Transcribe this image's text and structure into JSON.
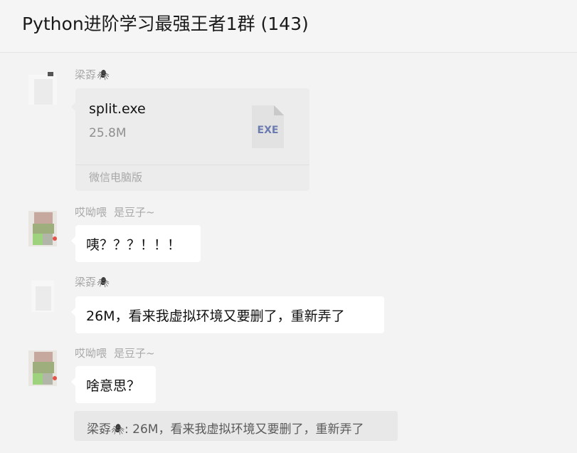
{
  "header": {
    "chat_title": "Python进阶学习最强王者1群 (143)"
  },
  "messages": [
    {
      "sender": "梁孬",
      "sender_badge": "🕷",
      "type": "file",
      "file": {
        "name": "split.exe",
        "size": "25.8M",
        "ext": "EXE",
        "source": "微信电脑版"
      }
    },
    {
      "sender": "哎呦喂",
      "sender_sub": "是豆子~",
      "type": "text",
      "text": "咦？？？！！！"
    },
    {
      "sender": "梁孬",
      "sender_badge": "🕷",
      "type": "text",
      "text": "26M，看来我虚拟环境又要删了，重新弄了"
    },
    {
      "sender": "哎呦喂",
      "sender_sub": "是豆子~",
      "type": "text",
      "text": "啥意思？",
      "quote": {
        "author": "梁孬",
        "badge": "🕷",
        "text": ": 26M，看来我虚拟环境又要删了，重新弄了"
      }
    }
  ],
  "icons": {
    "spider": "spider-icon",
    "file": "exe-file-icon"
  },
  "colors": {
    "background": "#f3f3f3",
    "bubble": "#ffffff",
    "file_card": "#ececec",
    "exe_label": "#6c7bb0",
    "name_text": "#a8a8a8"
  }
}
